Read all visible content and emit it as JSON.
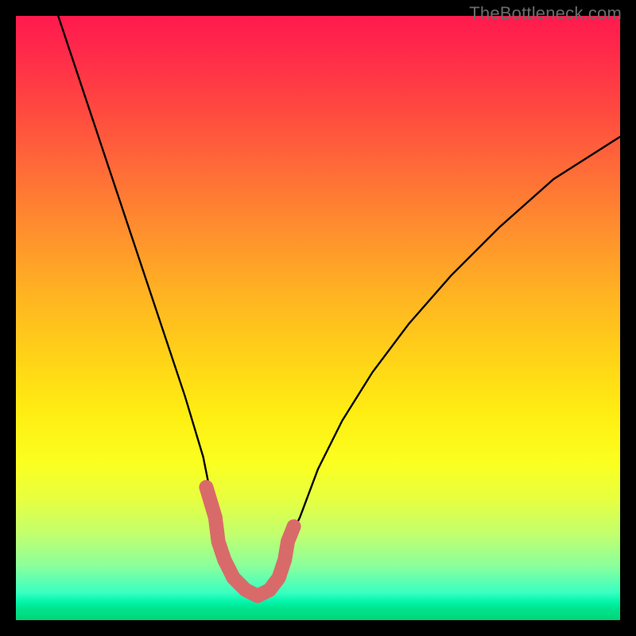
{
  "watermark": "TheBottleneck.com",
  "chart_data": {
    "type": "line",
    "title": "",
    "xlabel": "",
    "ylabel": "",
    "xlim": [
      0,
      100
    ],
    "ylim": [
      0,
      100
    ],
    "x": [
      7,
      10,
      13,
      16,
      19,
      22,
      25,
      28,
      31,
      33,
      33.5,
      34.5,
      36,
      38,
      40,
      42,
      43.5,
      44.5,
      45,
      47,
      50,
      54,
      59,
      65,
      72,
      80,
      89,
      100
    ],
    "values": [
      100,
      91,
      82,
      73,
      64,
      55,
      46,
      37,
      27,
      17,
      13,
      10,
      7,
      5,
      4,
      5,
      7,
      10,
      13,
      17,
      25,
      33,
      41,
      49,
      57,
      65,
      73,
      80
    ],
    "highlight_band": {
      "x": [
        31.5,
        33,
        33.5,
        34.5,
        36,
        38,
        40,
        42,
        43.5,
        44.5,
        45,
        46
      ],
      "values": [
        22,
        17,
        13,
        10,
        7,
        5,
        4,
        5,
        7,
        10,
        13,
        15.5
      ]
    },
    "gradient_stops": [
      {
        "pos": 0.0,
        "color": "#ff1a4d"
      },
      {
        "pos": 0.15,
        "color": "#ff4740"
      },
      {
        "pos": 0.35,
        "color": "#ff8d2e"
      },
      {
        "pos": 0.57,
        "color": "#ffd417"
      },
      {
        "pos": 0.74,
        "color": "#fbff20"
      },
      {
        "pos": 0.86,
        "color": "#c0ff70"
      },
      {
        "pos": 0.95,
        "color": "#38ffc2"
      },
      {
        "pos": 1.0,
        "color": "#00d577"
      }
    ],
    "highlight_color": "#d96a6a",
    "curve_color": "#000000"
  }
}
